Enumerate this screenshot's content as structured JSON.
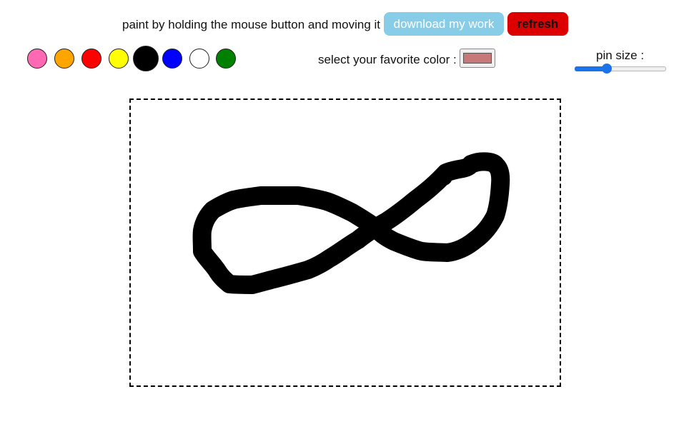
{
  "header": {
    "instruction": "paint by holding the mouse button and moving it",
    "download_label": "download my work",
    "refresh_label": "refresh"
  },
  "palette": {
    "swatches": [
      {
        "name": "pink",
        "color": "#ff69b4",
        "selected": false
      },
      {
        "name": "orange",
        "color": "#ffa500",
        "selected": false
      },
      {
        "name": "red",
        "color": "#ff0000",
        "selected": false
      },
      {
        "name": "yellow",
        "color": "#ffff00",
        "selected": false
      },
      {
        "name": "black",
        "color": "#000000",
        "selected": true
      },
      {
        "name": "blue",
        "color": "#0000ff",
        "selected": false
      },
      {
        "name": "white",
        "color": "#ffffff",
        "selected": false
      },
      {
        "name": "green",
        "color": "#008000",
        "selected": false
      }
    ]
  },
  "color_picker": {
    "label": "select your favorite color :",
    "value": "#c87878"
  },
  "pin_size": {
    "label": "pin size :",
    "fraction": 0.3
  },
  "colors": {
    "download_bg": "#87cde8",
    "refresh_bg": "#dd0000",
    "stroke": "#000000",
    "slider_accent": "#1a73e8"
  }
}
